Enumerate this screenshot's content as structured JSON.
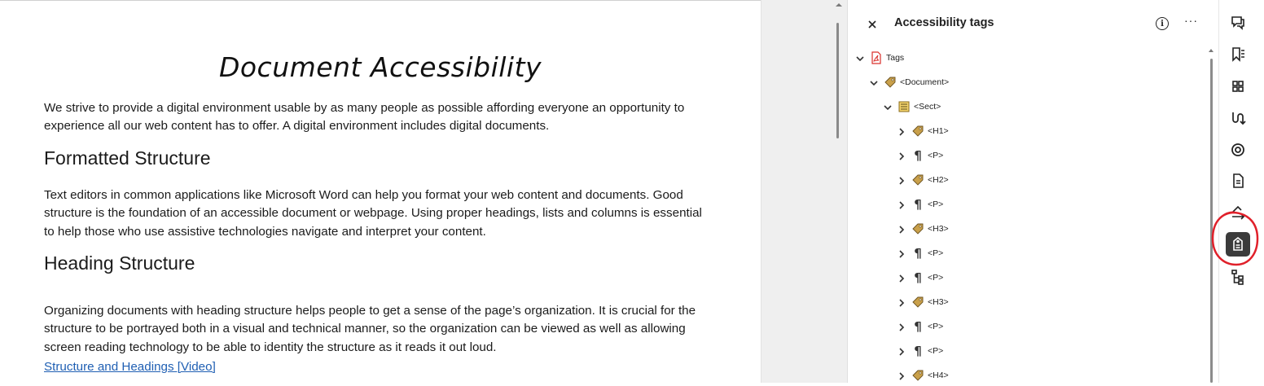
{
  "document": {
    "title": "Document Accessibility",
    "intro": "We strive to provide a digital environment usable by as many people as possible affording everyone an opportunity to experience all our web content has to offer. A digital environment includes digital documents.",
    "heading_formatted": "Formatted Structure",
    "formatted_text": "Text editors in common applications like Microsoft Word can help you format your web content and documents. Good structure is the foundation of an accessible document or webpage. Using proper headings, lists and columns is essential to help those who use assistive technologies navigate and interpret your content.",
    "heading_structure": "Heading Structure",
    "heading_text": "Organizing documents with heading structure helps people to get a sense of the page’s organization. It is crucial for the structure to be portrayed both in a visual and technical manner, so the organization can be viewed as well as allowing screen reading technology to be able to identity the structure as it reads it out loud.",
    "link_text": "Structure and Headings [Video]"
  },
  "panel": {
    "title": "Accessibility tags",
    "close_icon": "close-icon",
    "info_icon": "info-icon",
    "more_icon": "more-options-icon",
    "tree": [
      {
        "label": "Tags",
        "icon": "pdf-icon",
        "expanded": true
      },
      {
        "label": "<Document>",
        "icon": "tag-icon",
        "expanded": true
      },
      {
        "label": "<Sect>",
        "icon": "section-icon",
        "expanded": true
      },
      {
        "label": "<H1>",
        "icon": "tag-icon",
        "expanded": false
      },
      {
        "label": "<P>",
        "icon": "paragraph-icon",
        "expanded": false
      },
      {
        "label": "<H2>",
        "icon": "tag-icon",
        "expanded": false
      },
      {
        "label": "<P>",
        "icon": "paragraph-icon",
        "expanded": false
      },
      {
        "label": "<H3>",
        "icon": "tag-icon",
        "expanded": false
      },
      {
        "label": "<P>",
        "icon": "paragraph-icon",
        "expanded": false
      },
      {
        "label": "<P>",
        "icon": "paragraph-icon",
        "expanded": false
      },
      {
        "label": "<H3>",
        "icon": "tag-icon",
        "expanded": false
      },
      {
        "label": "<P>",
        "icon": "paragraph-icon",
        "expanded": false
      },
      {
        "label": "<P>",
        "icon": "paragraph-icon",
        "expanded": false
      },
      {
        "label": "<H4>",
        "icon": "tag-icon",
        "expanded": false
      }
    ]
  },
  "rail": {
    "items": [
      "comment-icon",
      "bookmark-icon",
      "thumbnails-icon",
      "order-icon",
      "target-icon",
      "document-icon",
      "convert-icon",
      "accessibility-tags-icon",
      "content-tree-icon"
    ],
    "active": "accessibility-tags-icon"
  },
  "colors": {
    "link": "#1f5fb3",
    "active_rail": "#3b3b3b",
    "highlight_circle": "#e0202a",
    "tag_icon": "#c9a04a",
    "pdf_icon": "#d9302c"
  }
}
